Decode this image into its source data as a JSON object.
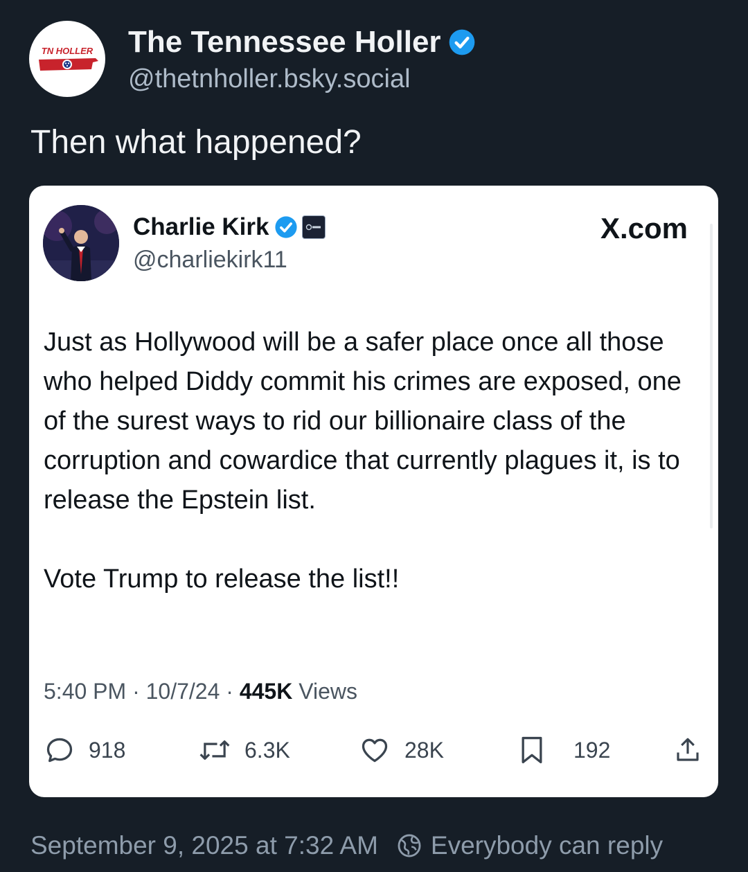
{
  "author": {
    "name": "The Tennessee Holler",
    "handle": "@thetnholler.bsky.social",
    "avatar_text": "TN HOLLER",
    "verified": true
  },
  "post": {
    "text": "Then what happened?"
  },
  "embed": {
    "source_label": "X.com",
    "author": {
      "name": "Charlie Kirk",
      "handle": "@charliekirk11",
      "verified": true
    },
    "body": [
      "Just as Hollywood will be a safer place once all those who helped Diddy commit his crimes are exposed, one of the surest ways to rid our billionaire class of the corruption and cowardice that currently plagues it, is to release the Epstein list.",
      "Vote Trump to release the list!!"
    ],
    "meta": {
      "time": "5:40 PM",
      "date": "10/7/24",
      "views_count": "445K",
      "views_label": "Views",
      "separator": " · "
    },
    "actions": {
      "replies": "918",
      "reposts": "6.3K",
      "likes": "28K",
      "bookmarks": "192"
    }
  },
  "footer": {
    "timestamp": "September 9, 2025 at 7:32 AM",
    "reply_setting": "Everybody can reply"
  },
  "colors": {
    "background": "#161e27",
    "verified_blue": "#1d9bf0",
    "card_background": "#ffffff",
    "muted_text": "#8e9cab"
  },
  "icons": {
    "verified": "verified-check-icon",
    "reply": "speech-bubble-icon",
    "repost": "repost-arrows-icon",
    "like": "heart-icon",
    "bookmark": "bookmark-icon",
    "share": "share-upload-icon",
    "reply_setting": "globe-icon"
  }
}
